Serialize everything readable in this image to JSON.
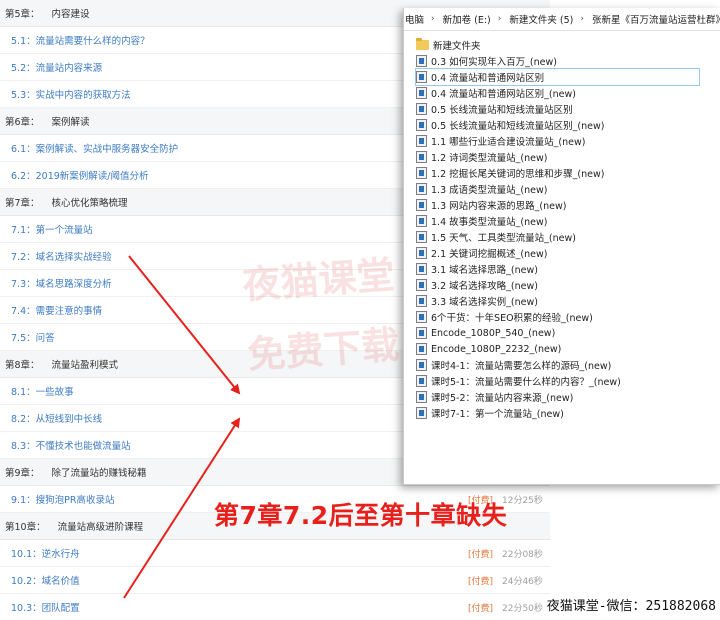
{
  "course": {
    "rows": [
      {
        "kind": "chapter",
        "num": "第5章：",
        "title": "内容建设"
      },
      {
        "kind": "lesson",
        "label": "5.1：流量站需要什么样的内容？",
        "paid": "",
        "duration": ""
      },
      {
        "kind": "lesson",
        "label": "5.2：流量站内容来源",
        "paid": "",
        "duration": ""
      },
      {
        "kind": "lesson",
        "label": "5.3：实战中内容的获取方法",
        "paid": "",
        "duration": ""
      },
      {
        "kind": "chapter",
        "num": "第6章：",
        "title": "案例解读"
      },
      {
        "kind": "lesson",
        "label": "6.1：案例解读、实战中服务器安全防护",
        "paid": "",
        "duration": ""
      },
      {
        "kind": "lesson",
        "label": "6.2：2019新案例解读/阈值分析",
        "paid": "",
        "duration": ""
      },
      {
        "kind": "chapter",
        "num": "第7章：",
        "title": "核心优化策略梳理"
      },
      {
        "kind": "lesson",
        "label": "7.1：第一个流量站",
        "paid": "",
        "duration": ""
      },
      {
        "kind": "lesson",
        "label": "7.2：域名选择实战经验",
        "paid": "",
        "duration": ""
      },
      {
        "kind": "lesson",
        "label": "7.3：域名思路深度分析",
        "paid": "",
        "duration": ""
      },
      {
        "kind": "lesson",
        "label": "7.4：需要注意的事情",
        "paid": "",
        "duration": ""
      },
      {
        "kind": "lesson",
        "label": "7.5：问答",
        "paid": "",
        "duration": ""
      },
      {
        "kind": "chapter",
        "num": "第8章：",
        "title": "流量站盈利模式"
      },
      {
        "kind": "lesson",
        "label": "8.1：一些故事",
        "paid": "",
        "duration": ""
      },
      {
        "kind": "lesson",
        "label": "8.2：从短线到中长线",
        "paid": "",
        "duration": ""
      },
      {
        "kind": "lesson",
        "label": "8.3：不懂技术也能做流量站",
        "paid": "",
        "duration": ""
      },
      {
        "kind": "chapter",
        "num": "第9章：",
        "title": "除了流量站的赚钱秘籍"
      },
      {
        "kind": "lesson",
        "label": "9.1：搜狗泡PR高收录站",
        "paid": "[付费]",
        "duration": "12分25秒"
      },
      {
        "kind": "chapter",
        "num": "第10章：",
        "title": "流量站高级进阶课程"
      },
      {
        "kind": "lesson",
        "label": "10.1：逆水行舟",
        "paid": "[付费]",
        "duration": "22分08秒"
      },
      {
        "kind": "lesson",
        "label": "10.2：域名价值",
        "paid": "[付费]",
        "duration": "24分46秒"
      },
      {
        "kind": "lesson",
        "label": "10.3：团队配置",
        "paid": "[付费]",
        "duration": "22分50秒"
      }
    ]
  },
  "explorer": {
    "breadcrumb": [
      "电脑",
      "新加卷 (E:)",
      "新建文件夹 (5)",
      "张新星《百万流量站运营杜群》"
    ],
    "separator": "›",
    "files": [
      {
        "name": "新建文件夹",
        "type": "folder",
        "selected": false
      },
      {
        "name": "0.3 如何实现年入百万_(new)",
        "type": "video",
        "selected": false
      },
      {
        "name": "0.4 流量站和普通网站区别",
        "type": "video",
        "selected": true
      },
      {
        "name": "0.4 流量站和普通网站区别_(new)",
        "type": "video",
        "selected": false
      },
      {
        "name": "0.5 长线流量站和短线流量站区别",
        "type": "video",
        "selected": false
      },
      {
        "name": "0.5 长线流量站和短线流量站区别_(new)",
        "type": "video",
        "selected": false
      },
      {
        "name": "1.1 哪些行业适合建设流量站_(new)",
        "type": "video",
        "selected": false
      },
      {
        "name": "1.2 诗词类型流量站_(new)",
        "type": "video",
        "selected": false
      },
      {
        "name": "1.2 挖掘长尾关键词的思维和步骤_(new)",
        "type": "video",
        "selected": false
      },
      {
        "name": "1.3 成语类型流量站_(new)",
        "type": "video",
        "selected": false
      },
      {
        "name": "1.3 网站内容来源的思路_(new)",
        "type": "video",
        "selected": false
      },
      {
        "name": "1.4 故事类型流量站_(new)",
        "type": "video",
        "selected": false
      },
      {
        "name": "1.5 天气、工具类型流量站_(new)",
        "type": "video",
        "selected": false
      },
      {
        "name": "2.1 关键词挖掘概述_(new)",
        "type": "video",
        "selected": false
      },
      {
        "name": "3.1 域名选择思路_(new)",
        "type": "video",
        "selected": false
      },
      {
        "name": "3.2 域名选择攻略_(new)",
        "type": "video",
        "selected": false
      },
      {
        "name": "3.3 域名选择实例_(new)",
        "type": "video",
        "selected": false
      },
      {
        "name": "6个干货：十年SEO积累的经验_(new)",
        "type": "video",
        "selected": false
      },
      {
        "name": "Encode_1080P_540_(new)",
        "type": "video",
        "selected": false
      },
      {
        "name": "Encode_1080P_2232_(new)",
        "type": "video",
        "selected": false
      },
      {
        "name": "课时4-1：流量站需要怎么样的源码_(new)",
        "type": "video",
        "selected": false
      },
      {
        "name": "课时5-1：流量站需要什么样的内容？_(new)",
        "type": "video",
        "selected": false
      },
      {
        "name": "课时5-2：流量站内容来源_(new)",
        "type": "video",
        "selected": false
      },
      {
        "name": "课时7-1：第一个流量站_(new)",
        "type": "video",
        "selected": false
      }
    ]
  },
  "annotation": {
    "text": "第7章7.2后至第十章缺失",
    "color": "#e8201c"
  },
  "watermark": {
    "line1": "夜猫课堂",
    "line2": "免费下载"
  },
  "footer_note": "夜猫课堂-微信：251882068",
  "colors": {
    "lesson_link": "#3d7bc4",
    "paid_tag": "#e8763a",
    "arrow": "#e8201c"
  }
}
